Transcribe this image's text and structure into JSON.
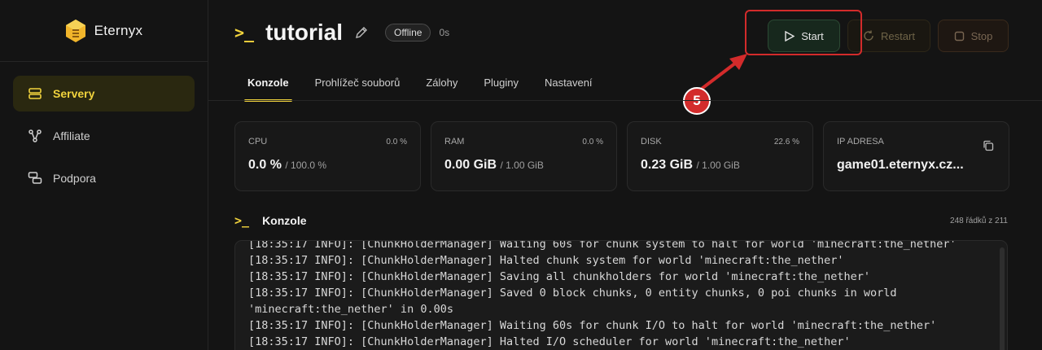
{
  "sidebar": {
    "brand": "Eternyx",
    "items": [
      {
        "label": "Servery",
        "icon": "server-icon",
        "active": true
      },
      {
        "label": "Affiliate",
        "icon": "network-icon",
        "active": false
      },
      {
        "label": "Podpora",
        "icon": "chat-icon",
        "active": false
      }
    ]
  },
  "header": {
    "title": "tutorial",
    "status": "Offline",
    "uptime": "0s"
  },
  "actions": {
    "start": "Start",
    "restart": "Restart",
    "stop": "Stop"
  },
  "annotation": {
    "step": "5",
    "color": "#d32b2b"
  },
  "tabs": [
    "Konzole",
    "Prohlížeč souborů",
    "Zálohy",
    "Pluginy",
    "Nastavení"
  ],
  "stats": {
    "cpu": {
      "label": "CPU",
      "pct": "0.0 %",
      "value": "0.0 %",
      "limit": "/ 100.0 %"
    },
    "ram": {
      "label": "RAM",
      "pct": "0.0 %",
      "value": "0.00 GiB",
      "limit": "/ 1.00 GiB"
    },
    "disk": {
      "label": "DISK",
      "pct": "22.6 %",
      "value": "0.23 GiB",
      "limit": "/ 1.00 GiB"
    },
    "ip": {
      "label": "IP ADRESA",
      "value": "game01.eternyx.cz..."
    }
  },
  "console": {
    "title": "Konzole",
    "line_count": "248 řádků z 211",
    "lines": [
      "[18:35:17 INFO]: [ChunkHolderManager] Waiting 60s for chunk system to halt for world 'minecraft:the_nether'",
      "[18:35:17 INFO]: [ChunkHolderManager] Halted chunk system for world 'minecraft:the_nether'",
      "[18:35:17 INFO]: [ChunkHolderManager] Saving all chunkholders for world 'minecraft:the_nether'",
      "[18:35:17 INFO]: [ChunkHolderManager] Saved 0 block chunks, 0 entity chunks, 0 poi chunks in world\n'minecraft:the_nether' in 0.00s",
      "[18:35:17 INFO]: [ChunkHolderManager] Waiting 60s for chunk I/O to halt for world 'minecraft:the_nether'",
      "[18:35:17 INFO]: [ChunkHolderManager] Halted I/O scheduler for world 'minecraft:the_nether'"
    ]
  },
  "colors": {
    "accent": "#f1d33d",
    "background": "#141414"
  }
}
